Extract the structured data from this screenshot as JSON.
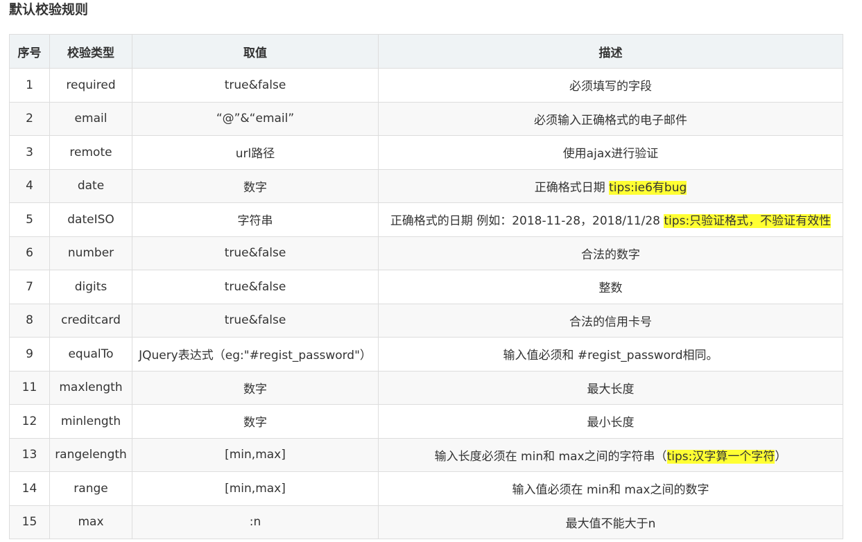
{
  "title": "默认校验规则",
  "colors": {
    "header_bg": "#eff3f5",
    "row_alt_bg": "#f8f8f8",
    "border": "#dddddd",
    "highlight": "#ffff33"
  },
  "table": {
    "headers": [
      "序号",
      "校验类型",
      "取值",
      "描述"
    ],
    "rows": [
      {
        "no": "1",
        "type": "required",
        "value": "true&false",
        "desc": "必须填写的字段",
        "tip": "",
        "after": ""
      },
      {
        "no": "2",
        "type": "email",
        "value": "“@”&“email”",
        "desc": "必须输入正确格式的电子邮件",
        "tip": "",
        "after": ""
      },
      {
        "no": "3",
        "type": "remote",
        "value": "url路径",
        "desc": "使用ajax进行验证",
        "tip": "",
        "after": ""
      },
      {
        "no": "4",
        "type": "date",
        "value": "数字",
        "desc": "正确格式日期 ",
        "tip": "tips:ie6有bug",
        "after": ""
      },
      {
        "no": "5",
        "type": "dateISO",
        "value": "字符串",
        "desc": "正确格式的日期 例如：2018-11-28，2018/11/28 ",
        "tip": "tips:只验证格式，不验证有效性",
        "after": ""
      },
      {
        "no": "6",
        "type": "number",
        "value": "true&false",
        "desc": "合法的数字",
        "tip": "",
        "after": ""
      },
      {
        "no": "7",
        "type": "digits",
        "value": "true&false",
        "desc": "整数",
        "tip": "",
        "after": ""
      },
      {
        "no": "8",
        "type": "creditcard",
        "value": "true&false",
        "desc": "合法的信用卡号",
        "tip": "",
        "after": ""
      },
      {
        "no": "9",
        "type": "equalTo",
        "value": "JQuery表达式（eg:\"#regist_password\"）",
        "desc": "输入值必须和 #regist_password相同。",
        "tip": "",
        "after": ""
      },
      {
        "no": "11",
        "type": "maxlength",
        "value": "数字",
        "desc": "最大长度",
        "tip": "",
        "after": ""
      },
      {
        "no": "12",
        "type": "minlength",
        "value": "数字",
        "desc": "最小长度",
        "tip": "",
        "after": ""
      },
      {
        "no": "13",
        "type": "rangelength",
        "value": "[min,max]",
        "desc": "输入长度必须在 min和 max之间的字符串（",
        "tip": "tips:汉字算一个字符",
        "after": "）"
      },
      {
        "no": "14",
        "type": "range",
        "value": "[min,max]",
        "desc": "输入值必须在 min和 max之间的数字",
        "tip": "",
        "after": ""
      },
      {
        "no": "15",
        "type": "max",
        "value": ":n",
        "desc": "最大值不能大于n",
        "tip": "",
        "after": ""
      }
    ]
  }
}
